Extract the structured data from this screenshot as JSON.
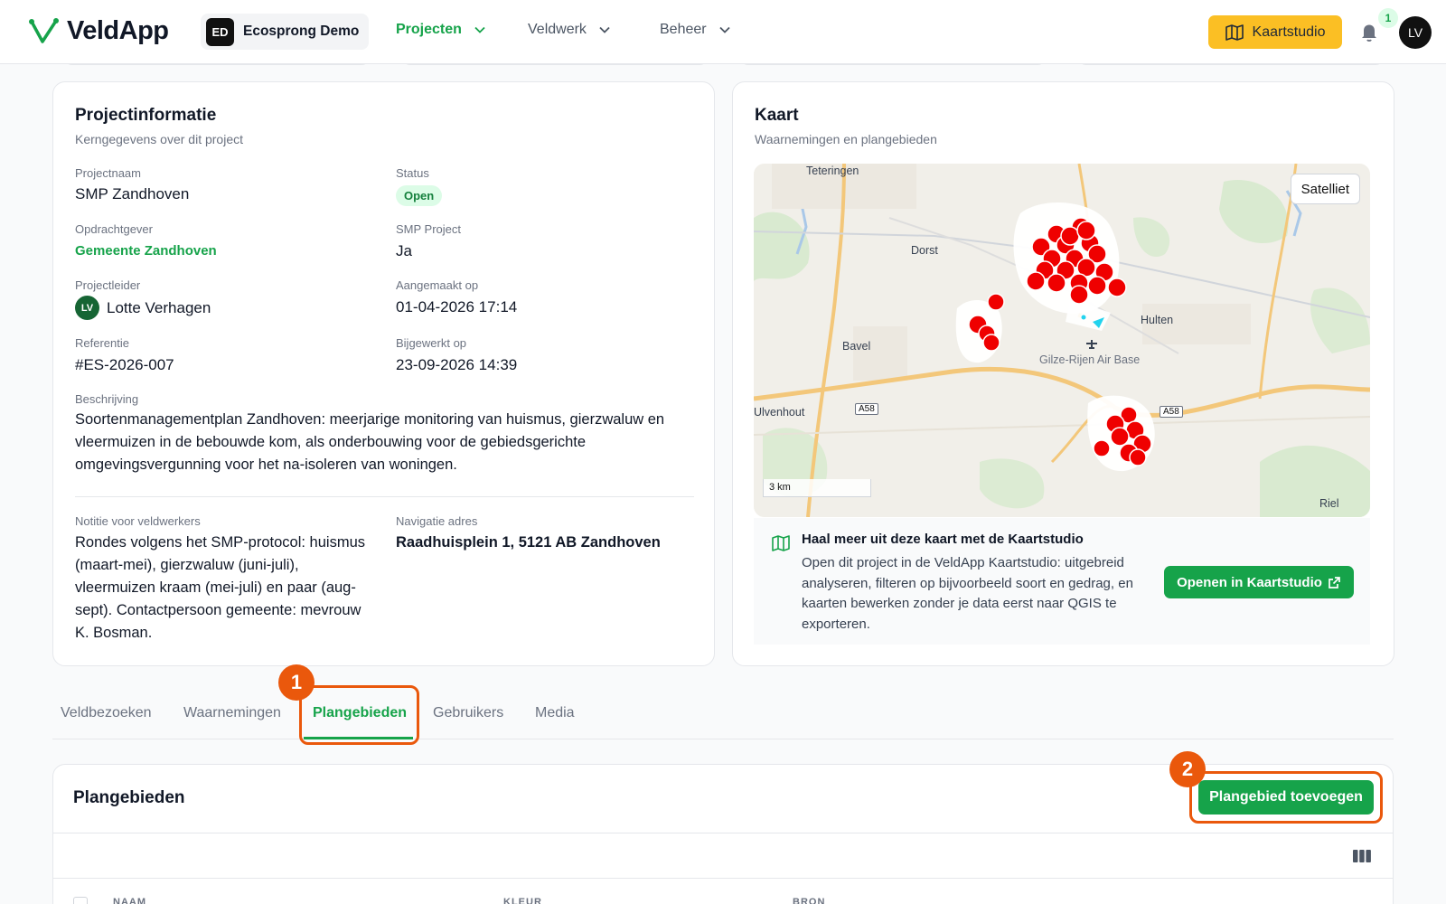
{
  "header": {
    "app_name": "VeldApp",
    "org_initials": "ED",
    "org_name": "Ecosprong Demo",
    "nav": [
      "Projecten",
      "Veldwerk",
      "Beheer"
    ],
    "kaartstudio_label": "Kaartstudio",
    "notification_count": "1",
    "user_initials": "LV"
  },
  "project_info": {
    "title": "Projectinformatie",
    "subtitle": "Kerngegevens over dit project",
    "name_label": "Projectnaam",
    "name": "SMP Zandhoven",
    "status_label": "Status",
    "status": "Open",
    "client_label": "Opdrachtgever",
    "client": "Gemeente Zandhoven",
    "smp_label": "SMP Project",
    "smp": "Ja",
    "lead_label": "Projectleider",
    "lead_initials": "LV",
    "lead": "Lotte Verhagen",
    "created_label": "Aangemaakt op",
    "created": "01-04-2026 17:14",
    "ref_label": "Referentie",
    "ref": "#ES-2026-007",
    "updated_label": "Bijgewerkt op",
    "updated": "23-09-2026 14:39",
    "desc_label": "Beschrijving",
    "desc": "Soortenmanagementplan Zandhoven: meerjarige monitoring van huismus, gierzwaluw en vleermuizen in de bebouwde kom, als onderbouwing voor de gebiedsgerichte omgevingsvergunning voor het na-isoleren van woningen.",
    "note_label": "Notitie voor veldwerkers",
    "note": "Rondes volgens het SMP-protocol: huismus (maart-mei), gierzwaluw (juni-juli), vleermuizen kraam (mei-juli) en paar (aug-sept). Contactpersoon gemeente: mevrouw K. Bosman.",
    "nav_label": "Navigatie adres",
    "nav_address": "Raadhuisplein 1, 5121 AB Zandhoven"
  },
  "map_card": {
    "title": "Kaart",
    "subtitle": "Waarnemingen en plangebieden",
    "satellite_label": "Satelliet",
    "scale": "3 km",
    "places": [
      "Teteringen",
      "Dorst",
      "Bavel",
      "Hulten",
      "Gilze-Rijen Air Base",
      "Ulvenhout",
      "Riel"
    ],
    "road_tags": [
      "A58",
      "A58"
    ],
    "promo_title": "Haal meer uit deze kaart met de Kaartstudio",
    "promo_text": "Open dit project in de VeldApp Kaartstudio: uitgebreid analyseren, filteren op bijvoorbeeld soort en gedrag, en kaarten bewerken zonder je data eerst naar QGIS te exporteren.",
    "promo_button": "Openen in Kaartstudio"
  },
  "tabs": [
    "Veldbezoeken",
    "Waarnemingen",
    "Plangebieden",
    "Gebruikers",
    "Media"
  ],
  "steps": [
    "1",
    "2"
  ],
  "plangebieden": {
    "title": "Plangebieden",
    "add_button": "Plangebied toevoegen",
    "columns": [
      "NAAM",
      "KLEUR",
      "BRON"
    ]
  }
}
